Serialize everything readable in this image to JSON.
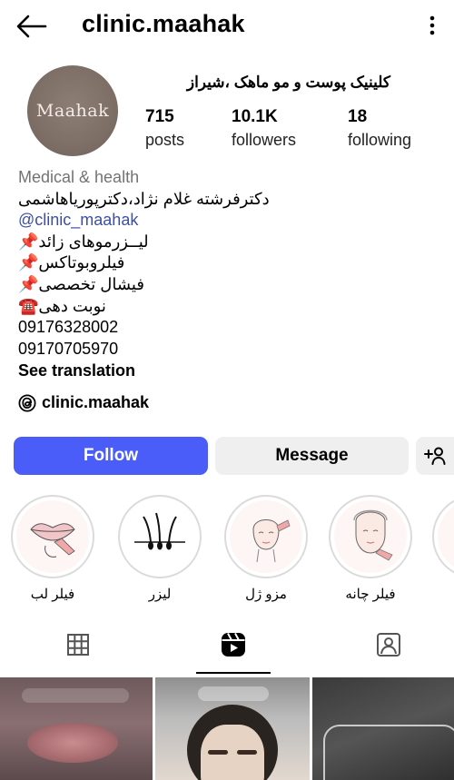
{
  "header": {
    "username": "clinic.maahak"
  },
  "profile": {
    "avatar_text": "Maahak",
    "display_name": "کلینیک پوست و مو ماهک ،شیراز",
    "stats": [
      {
        "value": "715",
        "label": "posts"
      },
      {
        "value": "10.1K",
        "label": "followers"
      },
      {
        "value": "18",
        "label": "following"
      }
    ]
  },
  "bio": {
    "category": "Medical & health",
    "doctors": "دکترفرشته غلام نژاد،دکترپوریاهاشمی",
    "mention": "@clinic_maahak",
    "services": [
      "لیــزرموهای زائد📌",
      "فیلروبوتاکس📌",
      "فیشال تخصصی📌"
    ],
    "booking": "نوبت دهی☎️",
    "phones": [
      "09176328002",
      "09170705970"
    ],
    "see_translation": "See translation"
  },
  "threads": {
    "label": "clinic.maahak"
  },
  "actions": {
    "follow": "Follow",
    "message": "Message"
  },
  "highlights": [
    {
      "label": "فیلر لب"
    },
    {
      "label": "لیزر"
    },
    {
      "label": "مزو ژل"
    },
    {
      "label": "فیلر چانه"
    }
  ],
  "colors": {
    "follow_button": "#4a5df9",
    "secondary_button": "#efefef",
    "link": "#3b4fa8",
    "category": "#737373"
  }
}
